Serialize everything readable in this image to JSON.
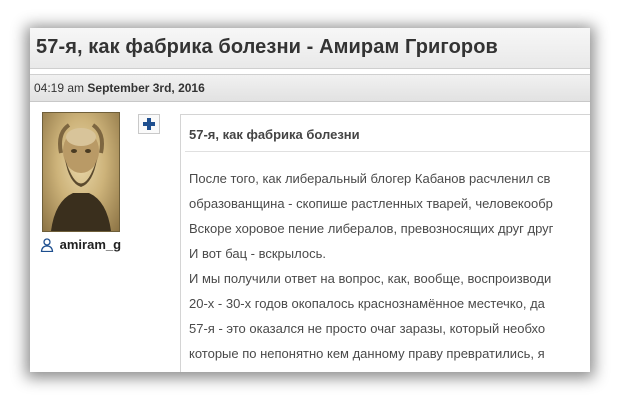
{
  "page": {
    "title": "57-я, как фабрика болезни - Амирам Григоров"
  },
  "post_meta": {
    "time": "04:19 am",
    "date": "September 3rd, 2016"
  },
  "author": {
    "username": "amiram_g",
    "user_icon": "user-icon",
    "avatar": "portrait photo (sepia)"
  },
  "actions": {
    "add_icon": "plus-icon"
  },
  "post": {
    "heading": "57-я, как фабрика болезни",
    "lines": [
      "После того, как либеральный блогер Кабанов расчленил св",
      "образованщина - скопише растленных тварей, человекообр",
      "Вскоре хоровое пение либералов, превозносящих друг друг",
      "И вот бац - вскрылось.",
      "И мы получили ответ на вопрос, как, вообще, воспроизводи",
      "20-х - 30-х годов окопалось краснознамённое местечко, да",
      "57-я - это оказался не просто очаг заразы, который необхо",
      "которые по непонятно кем данному праву превратились, я"
    ]
  },
  "colors": {
    "accent_plus": "#1e4f8f",
    "text": "#4a4a4a"
  }
}
